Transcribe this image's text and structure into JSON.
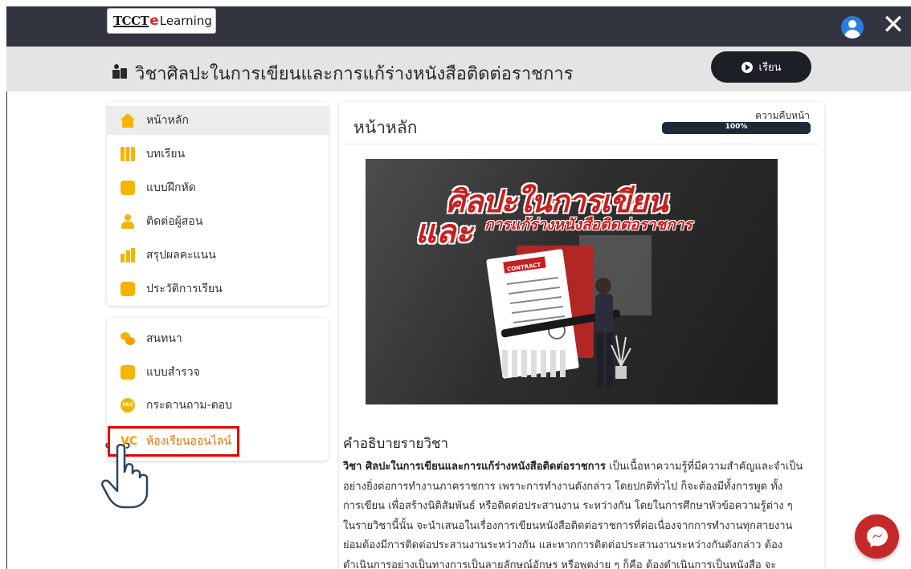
{
  "app": {
    "logo_prefix": "TCCT",
    "logo_e": "e",
    "logo_suffix": "Learning"
  },
  "header": {
    "course_title": "วิชาศิลปะในการเขียนและการแก้ร่างหนังสือติดต่อราชการ",
    "learn_button": "เรียน",
    "user_icon": "user-circle-icon",
    "close_icon": "close-icon"
  },
  "sidebar": {
    "main_items": [
      {
        "label": "หน้าหลัก",
        "icon": "home-icon"
      },
      {
        "label": "บทเรียน",
        "icon": "grid-icon"
      },
      {
        "label": "แบบฝึกหัด",
        "icon": "book-icon"
      },
      {
        "label": "ติดต่อผู้สอน",
        "icon": "person-icon"
      },
      {
        "label": "สรุปผลคะแนน",
        "icon": "chart-icon"
      },
      {
        "label": "ประวัติการเรียน",
        "icon": "calculator-icon"
      }
    ],
    "extra_items": [
      {
        "label": "สนทนา",
        "icon": "chat-icon"
      },
      {
        "label": "แบบสำรวจ",
        "icon": "survey-icon"
      },
      {
        "label": "กระดานถาม-ตอบ",
        "icon": "faq-icon",
        "badge": "FAQ"
      },
      {
        "label": "ห้องเรียนออนไลน์",
        "icon": "vc-icon",
        "badge": "VC"
      }
    ]
  },
  "main": {
    "title": "หน้าหลัก",
    "progress_label": "ความคืบหน้า",
    "progress_value": 100,
    "progress_text": "100%",
    "banner": {
      "line1": "ศิลปะในการเขียน",
      "line2_big": "และ",
      "line2_small": "การแก้ร่างหนังสือติดต่อราชการ",
      "contract_label": "CONTRACT"
    },
    "description_title": "คำอธิบายรายวิชา",
    "description_bold": "วิชา ศิลปะในการเขียนและการแก้ร่างหนังสือติดต่อราชการ",
    "description_lines": [
      " เป็นเนื้อหาความรู้ที่มีความสำคัญและจำเป็น",
      "อย่างยิ่งต่อการทำงานภาคราชการ เพราะการทำงานดังกล่าว โดยปกติทั่วไป ก็จะต้องมีทั้งการพูด ทั้ง",
      "การเขียน เพื่อสร้างนิติสัมพันธ์ หรือติดต่อประสานงาน ระหว่างกัน โดยในการศึกษาหัวข้อความรู้ต่าง ๆ",
      "ในรายวิชานี้นั้น จะนำเสนอในเรื่องการเขียนหนังสือติดต่อราชการที่ต่อเนื่องจากการทำงานทุกสายงาน",
      "ย่อมต้องมีการติดต่อประสานงานระหว่างกัน และหากการติดต่อประสานงานระหว่างกันดังกล่าว ต้อง",
      "ดำเนินการอย่างเป็นทางการเป็นลายลักษณ์อักษร หรือพูดง่าย ๆ ก็คือ ต้องดำเนินการเป็นหนังสือ จะ"
    ]
  },
  "colors": {
    "topbar": "#32353f",
    "accent": "#f5b400",
    "highlight": "#e60000",
    "messenger": "#c62828"
  },
  "messenger_icon": "messenger-icon"
}
